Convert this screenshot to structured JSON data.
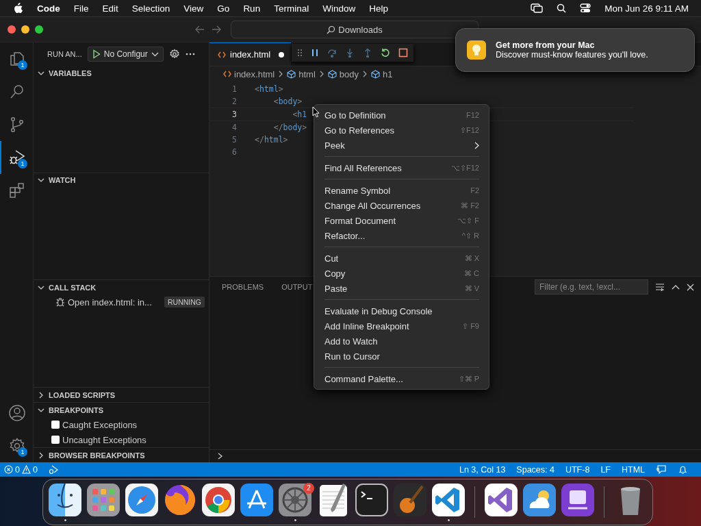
{
  "menubar": {
    "app": "Code",
    "menus": [
      "File",
      "Edit",
      "Selection",
      "View",
      "Go",
      "Run",
      "Terminal",
      "Window",
      "Help"
    ],
    "clock": "Mon Jun 26  9:11 AM"
  },
  "window": {
    "search": "Downloads"
  },
  "activity_bar": [
    {
      "kind": "explorer",
      "badge": "1",
      "selected": false
    },
    {
      "kind": "search",
      "selected": false
    },
    {
      "kind": "scm",
      "selected": false
    },
    {
      "kind": "debug",
      "badge": "1",
      "selected": true
    },
    {
      "kind": "extensions",
      "selected": false
    }
  ],
  "activity_bottom": [
    {
      "kind": "account"
    },
    {
      "kind": "settings",
      "badge": "1"
    }
  ],
  "sidebar": {
    "title": "RUN AN...",
    "configuration": "No Configur",
    "sections": [
      {
        "title": "VARIABLES",
        "expanded": true,
        "kind": "empty"
      },
      {
        "title": "WATCH",
        "expanded": true,
        "kind": "empty"
      },
      {
        "title": "CALL STACK",
        "expanded": true,
        "kind": "stack",
        "items": [
          {
            "label": "Open index.html: in...",
            "status": "RUNNING"
          }
        ]
      },
      {
        "title": "LOADED SCRIPTS",
        "expanded": false,
        "kind": "empty"
      },
      {
        "title": "BREAKPOINTS",
        "expanded": true,
        "kind": "checks",
        "items": [
          {
            "label": "Caught Exceptions",
            "checked": false
          },
          {
            "label": "Uncaught Exceptions",
            "checked": false
          }
        ]
      },
      {
        "title": "BROWSER BREAKPOINTS",
        "expanded": false,
        "kind": "empty"
      }
    ]
  },
  "editor": {
    "tab": {
      "label": "index.html",
      "modified": true
    },
    "breadcrumbs": [
      {
        "label": "index.html",
        "kind": "file"
      },
      {
        "label": "html",
        "kind": "element"
      },
      {
        "label": "body",
        "kind": "element"
      },
      {
        "label": "h1",
        "kind": "element"
      }
    ],
    "lines": [
      {
        "number": "1",
        "code": "<html>",
        "current": false
      },
      {
        "number": "2",
        "code": "    <body>",
        "current": false
      },
      {
        "number": "3",
        "code": "        <h1",
        "current": true
      },
      {
        "number": "4",
        "code": "    </body>",
        "current": false
      },
      {
        "number": "5",
        "code": "</html>",
        "current": false
      },
      {
        "number": "6",
        "current": false
      }
    ]
  },
  "panel": {
    "tabs": [
      {
        "label": "PROBLEMS",
        "selected": false
      },
      {
        "label": "OUTPUT",
        "selected": false
      }
    ],
    "filter_placeholder": "Filter (e.g. text, !excl..."
  },
  "context_menu": [
    [
      {
        "label": "Go to Definition",
        "shortcut": "F12",
        "submenu": false
      },
      {
        "label": "Go to References",
        "shortcut": "⇧F12",
        "submenu": false
      },
      {
        "label": "Peek",
        "submenu": true
      }
    ],
    [
      {
        "label": "Find All References",
        "shortcut": "⌥⇧F12",
        "submenu": false
      }
    ],
    [
      {
        "label": "Rename Symbol",
        "shortcut": "F2",
        "submenu": false
      },
      {
        "label": "Change All Occurrences",
        "shortcut": "⌘ F2",
        "submenu": false
      },
      {
        "label": "Format Document",
        "shortcut": "⌥⇧ F",
        "submenu": false
      },
      {
        "label": "Refactor...",
        "shortcut": "^⇧ R",
        "submenu": false
      }
    ],
    [
      {
        "label": "Cut",
        "shortcut": "⌘ X",
        "submenu": false
      },
      {
        "label": "Copy",
        "shortcut": "⌘ C",
        "submenu": false
      },
      {
        "label": "Paste",
        "shortcut": "⌘ V",
        "submenu": false
      }
    ],
    [
      {
        "label": "Evaluate in Debug Console",
        "submenu": false
      },
      {
        "label": "Add Inline Breakpoint",
        "shortcut": "⇧ F9",
        "submenu": false
      },
      {
        "label": "Add to Watch",
        "submenu": false
      },
      {
        "label": "Run to Cursor",
        "submenu": false
      }
    ],
    [
      {
        "label": "Command Palette...",
        "shortcut": "⇧⌘ P",
        "submenu": false
      }
    ]
  ],
  "notification": {
    "title": "Get more from your Mac",
    "body": "Discover must-know features you'll love."
  },
  "status_bar": {
    "errors": "0",
    "warnings": "0",
    "items": [
      "Ln 3, Col 13",
      "Spaces: 4",
      "UTF-8",
      "LF",
      "HTML"
    ]
  },
  "dock": [
    {
      "kind": "finder",
      "running": true
    },
    {
      "kind": "launchpad",
      "running": false
    },
    {
      "kind": "safari",
      "running": false
    },
    {
      "kind": "firefox",
      "running": false
    },
    {
      "kind": "chrome",
      "running": false
    },
    {
      "kind": "appstore",
      "running": false
    },
    {
      "kind": "settings",
      "running": true,
      "badge": "2"
    },
    {
      "kind": "textedit",
      "running": false
    },
    {
      "kind": "terminal",
      "running": false
    },
    {
      "kind": "garageband",
      "running": false
    },
    {
      "kind": "vscode",
      "running": true
    },
    {
      "kind": "separator"
    },
    {
      "kind": "visualstudio",
      "running": false
    },
    {
      "kind": "weather",
      "running": false
    },
    {
      "kind": "purple",
      "running": false
    },
    {
      "kind": "separator"
    },
    {
      "kind": "trash",
      "running": false
    }
  ]
}
